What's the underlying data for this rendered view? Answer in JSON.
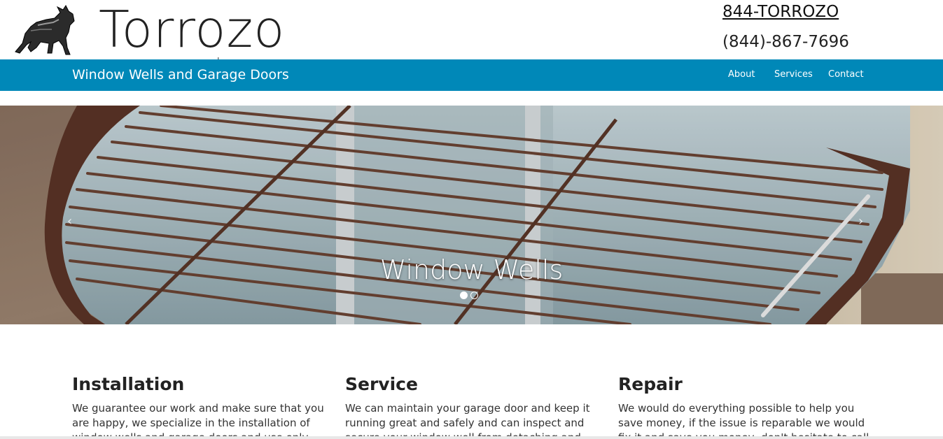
{
  "header": {
    "brand": "Torrozo",
    "phone_vanity": "844-TORROZO",
    "phone_number": "(844)-867-7696",
    "logo_icon": "bull-icon"
  },
  "navbar": {
    "tagline": "Window Wells and Garage Doors",
    "items": [
      {
        "label": "About"
      },
      {
        "label": "Services"
      },
      {
        "label": "Contact"
      }
    ],
    "color": "#0088b8"
  },
  "hero": {
    "caption": "Window Wells",
    "slide_count": 2,
    "active_slide": 1
  },
  "columns": [
    {
      "title": "Installation",
      "text": "We guarantee our work and make sure that you are happy, we specialize in the installation of window wells and garage doors and use only high quality"
    },
    {
      "title": "Service",
      "text": "We can maintain your garage door and keep it running great and safely and can inspect and secure your window well from detaching and from"
    },
    {
      "title": "Repair",
      "text": "We would do everything possible to help you save money, if the issue is reparable we would fix it and save you money, don't hesitate to call or click for a"
    }
  ]
}
